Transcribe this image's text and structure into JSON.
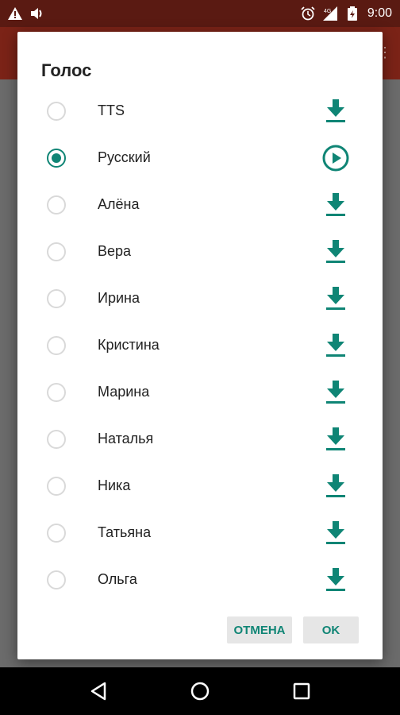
{
  "status_bar": {
    "time": "9:00",
    "icons": [
      "warning-icon",
      "volume-icon",
      "alarm-icon",
      "network-4g-icon",
      "battery-icon"
    ]
  },
  "dialog": {
    "title": "Голос",
    "voices": [
      {
        "label": "TTS",
        "selected": false,
        "action": "download-icon"
      },
      {
        "label": "Русский",
        "selected": true,
        "action": "play-icon"
      },
      {
        "label": "Алёна",
        "selected": false,
        "action": "download-icon"
      },
      {
        "label": "Вера",
        "selected": false,
        "action": "download-icon"
      },
      {
        "label": "Ирина",
        "selected": false,
        "action": "download-icon"
      },
      {
        "label": "Кристина",
        "selected": false,
        "action": "download-icon"
      },
      {
        "label": "Марина",
        "selected": false,
        "action": "download-icon"
      },
      {
        "label": "Наталья",
        "selected": false,
        "action": "download-icon"
      },
      {
        "label": "Ника",
        "selected": false,
        "action": "download-icon"
      },
      {
        "label": "Татьяна",
        "selected": false,
        "action": "download-icon"
      },
      {
        "label": "Ольга",
        "selected": false,
        "action": "download-icon"
      }
    ],
    "cancel_label": "ОТМЕНА",
    "ok_label": "OK"
  },
  "colors": {
    "accent": "#0f8575",
    "app_bar": "#7b2317",
    "status_bar": "#5a1a12"
  }
}
